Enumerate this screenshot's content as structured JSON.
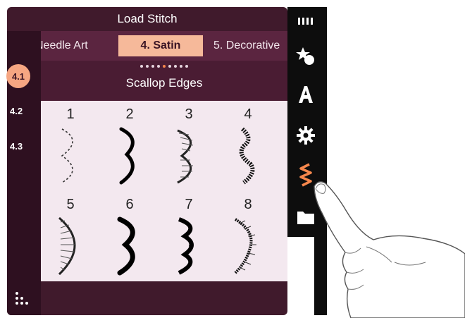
{
  "window": {
    "title": "Load Stitch"
  },
  "tabs": [
    {
      "label": "Needle Art",
      "active": false
    },
    {
      "label": "4. Satin",
      "active": true
    },
    {
      "label": "5. Decorative",
      "active": false
    }
  ],
  "pager": {
    "total": 9,
    "active_index": 4
  },
  "category": {
    "title": "Scallop Edges"
  },
  "subtabs": [
    {
      "label": "4.1",
      "active": true
    },
    {
      "label": "4.2",
      "active": false
    },
    {
      "label": "4.3",
      "active": false
    }
  ],
  "stitches": [
    {
      "number": "1",
      "icon": "dashed-scallop-icon"
    },
    {
      "number": "2",
      "icon": "solid-scallop-icon"
    },
    {
      "number": "3",
      "icon": "fringed-scallop-icon"
    },
    {
      "number": "4",
      "icon": "textured-wave-icon"
    },
    {
      "number": "5",
      "icon": "large-fringed-scallop-icon"
    },
    {
      "number": "6",
      "icon": "bold-scallop-icon"
    },
    {
      "number": "7",
      "icon": "double-crescent-scallop-icon"
    },
    {
      "number": "8",
      "icon": "feathered-wave-icon"
    }
  ],
  "toolbar": {
    "items": [
      {
        "name": "menu-bars-icon"
      },
      {
        "name": "stitch-menu-icon"
      },
      {
        "name": "font-icon"
      },
      {
        "name": "settings-gear-icon"
      },
      {
        "name": "stitch-zigzag-icon",
        "active": true
      },
      {
        "name": "folder-icon"
      }
    ]
  },
  "colors": {
    "background_dark": "#401a2c",
    "tab_bar": "#5b2540",
    "active_accent": "#f6b99a",
    "active_orange": "#f6874c",
    "grid_background": "#f3e8ef",
    "toolbar": "#0d0d0d"
  }
}
